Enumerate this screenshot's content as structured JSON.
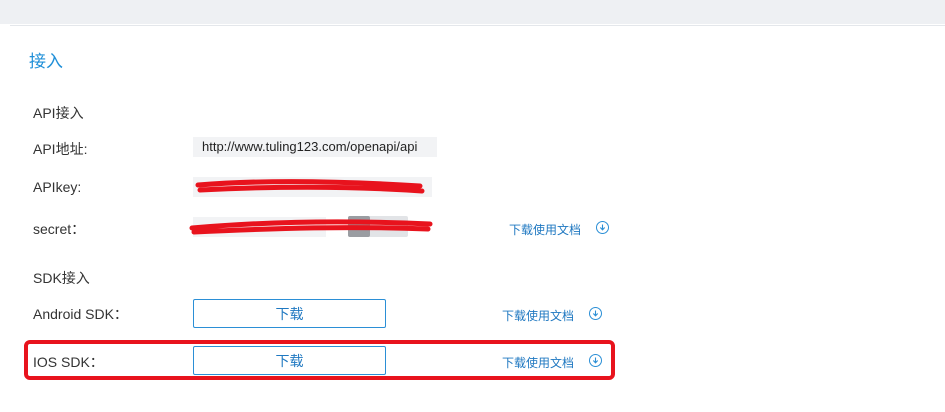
{
  "section": {
    "title": "接入"
  },
  "api": {
    "heading": "API接入",
    "address": {
      "label": "API地址:",
      "value": "http://www.tuling123.com/openapi/api"
    },
    "key": {
      "label": "APIkey:",
      "value": ""
    },
    "secret": {
      "label": "secret：",
      "value": "",
      "doc_link": "下载使用文档"
    }
  },
  "sdk": {
    "heading": "SDK接入",
    "android": {
      "label": "Android SDK：",
      "button": "下载",
      "doc_link": "下载使用文档"
    },
    "ios": {
      "label": "IOS SDK：",
      "button": "下载",
      "doc_link": "下载使用文档"
    }
  },
  "colors": {
    "accent": "#1f8fd8",
    "annotation_red": "#e8131d"
  },
  "icons": {
    "download": "download-circle-icon"
  }
}
